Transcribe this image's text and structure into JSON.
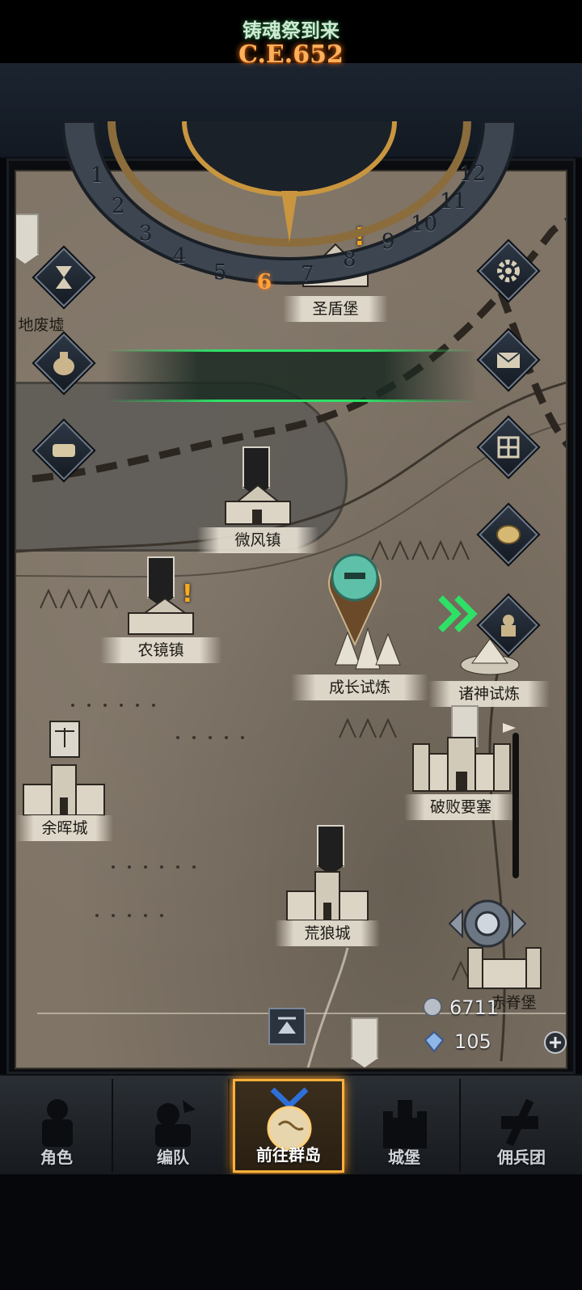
{
  "calendar": {
    "era_label": "C.E.652",
    "months": [
      "1",
      "2",
      "3",
      "4",
      "5",
      "6",
      "7",
      "8",
      "9",
      "10",
      "11",
      "12"
    ],
    "current_month": "6"
  },
  "event_banner": {
    "text": "铸魂祭到来"
  },
  "locations": {
    "weifeng": "微风镇",
    "nongjing": "农镜镇",
    "chengzhang": "成长试炼",
    "zhushen": "诸神试炼",
    "pobai": "破败要塞",
    "yuhui": "余晖城",
    "huanglang": "荒狼城",
    "chibei": "赤脊堡",
    "feixu": "地废墟",
    "shengdun": "圣盾堡"
  },
  "left_buttons": [
    "hourglass-icon",
    "bag-icon",
    "scroll-icon"
  ],
  "right_buttons": [
    "gear-icon",
    "mail-icon",
    "window-icon",
    "coin-icon",
    "knight-icon"
  ],
  "resources": {
    "silver": "6711",
    "crystal": "105"
  },
  "bottom_nav": [
    {
      "label": "角色",
      "icon": "character-icon"
    },
    {
      "label": "编队",
      "icon": "formation-icon"
    },
    {
      "label": "前往群岛",
      "icon": "islands-icon"
    },
    {
      "label": "城堡",
      "icon": "castle-icon"
    },
    {
      "label": "佣兵团",
      "icon": "mercenary-icon"
    }
  ],
  "colors": {
    "accent_orange": "#ffb13a",
    "event_green": "#2fe067",
    "map_parchment": "#7f7466"
  }
}
